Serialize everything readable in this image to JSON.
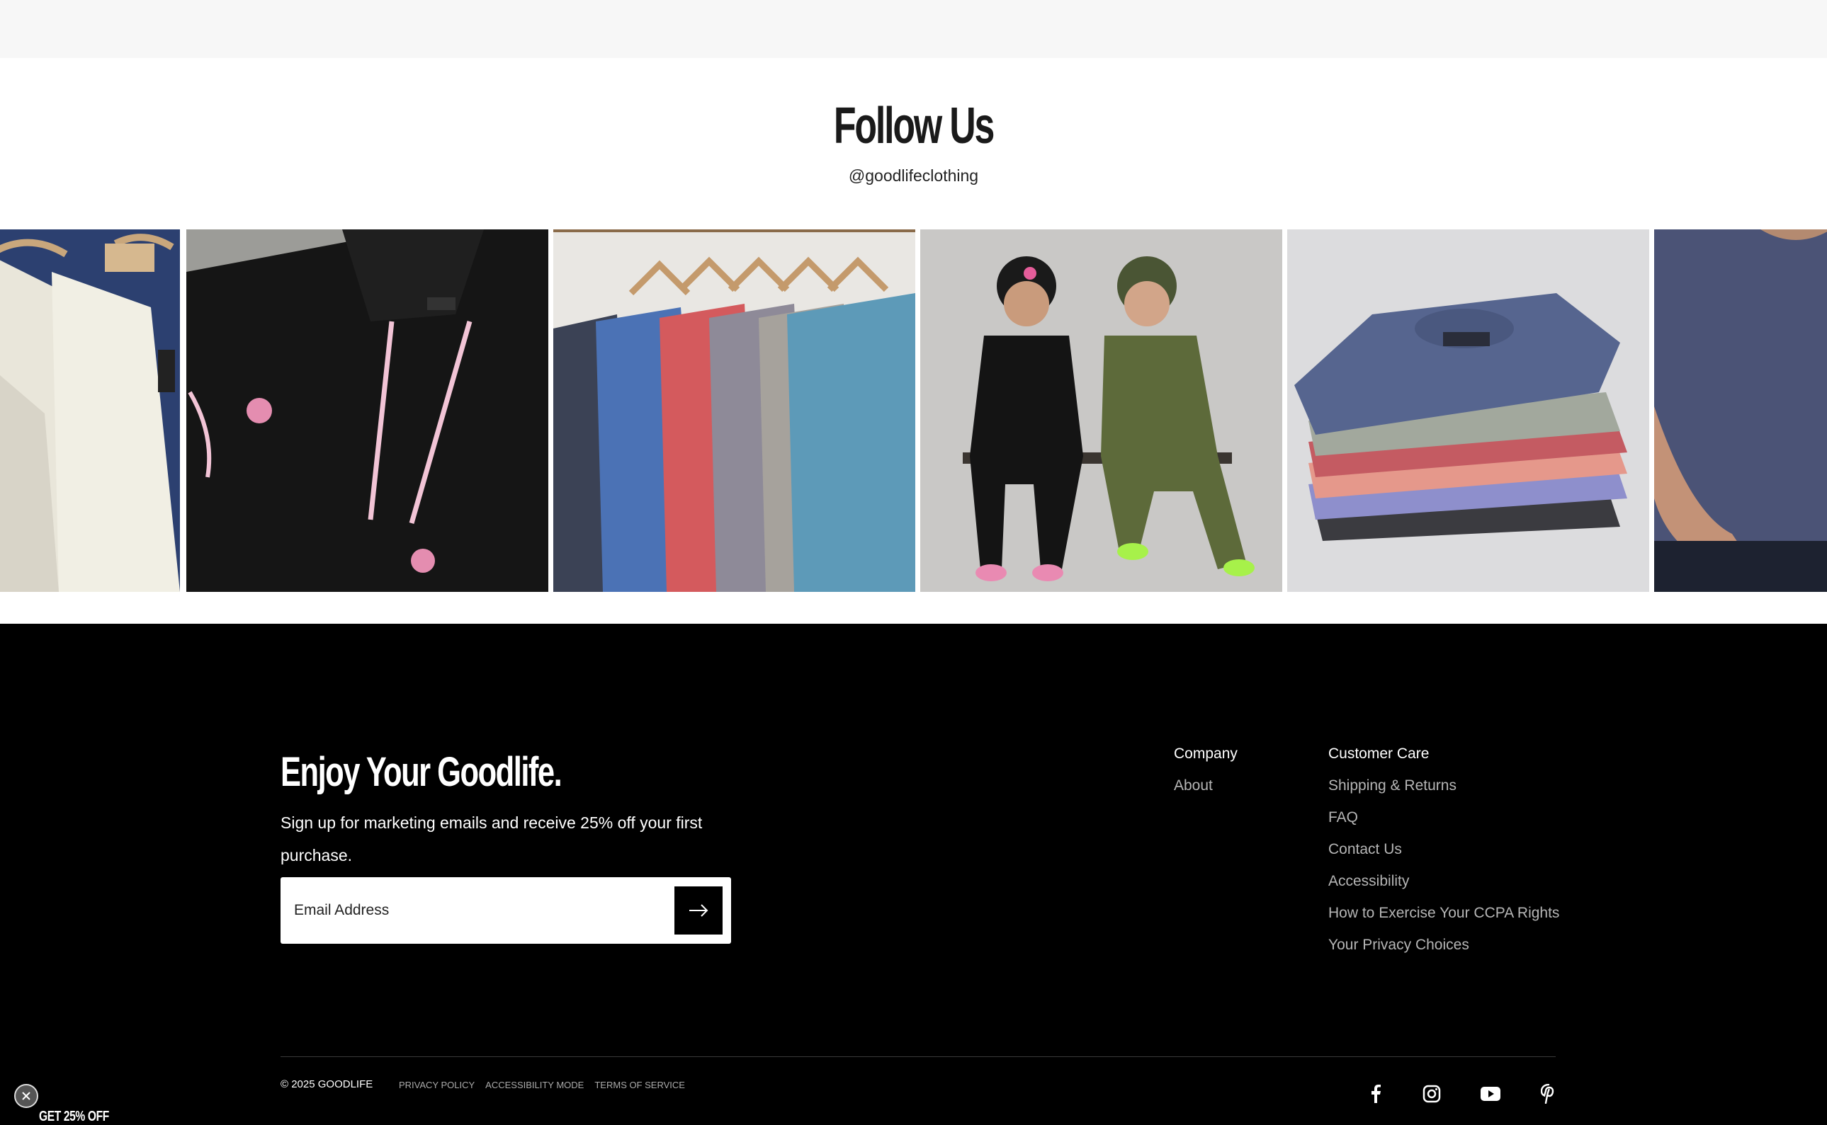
{
  "follow": {
    "title": "Follow Us",
    "handle": "@goodlifeclothing"
  },
  "gallery": {
    "items": [
      {
        "name": "white-hoodies-on-hangers"
      },
      {
        "name": "black-hoodie-pink-drawstrings"
      },
      {
        "name": "tees-on-hangers"
      },
      {
        "name": "two-men-in-sweatsuits"
      },
      {
        "name": "folded-tee-stack"
      },
      {
        "name": "man-in-blue-tee"
      }
    ]
  },
  "footer": {
    "signup": {
      "title": "Enjoy Your Goodlife.",
      "text": "Sign up for marketing emails and receive 25% off your first purchase.",
      "email_placeholder": "Email Address"
    },
    "company": {
      "heading": "Company",
      "links": [
        "About"
      ]
    },
    "customer_care": {
      "heading": "Customer Care",
      "links": [
        "Shipping & Returns",
        "FAQ",
        "Contact Us",
        "Accessibility",
        "How to Exercise Your CCPA Rights",
        "Your Privacy Choices"
      ]
    },
    "copyright": "© 2025 GOODLIFE",
    "legal_links": [
      "PRIVACY POLICY",
      "ACCESSIBILITY MODE",
      "TERMS OF SERVICE"
    ],
    "social": [
      "facebook-icon",
      "instagram-icon",
      "youtube-icon",
      "pinterest-icon"
    ]
  },
  "promo": {
    "label": "GET 25% OFF"
  },
  "colors": {
    "footer_bg": "#000000",
    "top_band": "#f7f7f7",
    "link_gray": "#b5b5b5"
  }
}
